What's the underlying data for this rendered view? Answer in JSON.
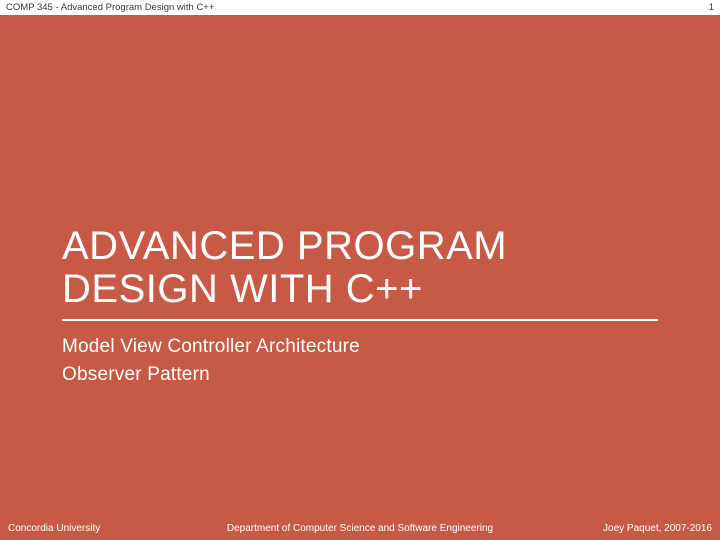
{
  "header": {
    "course": "COMP 345 - Advanced Program Design with C++",
    "page_number": "1"
  },
  "title": "ADVANCED PROGRAM DESIGN WITH C++",
  "subtitles": [
    "Model View Controller Architecture",
    "Observer Pattern"
  ],
  "footer": {
    "left": "Concordia University",
    "center": "Department of Computer Science and Software Engineering",
    "right": "Joey Paquet, 2007-2016"
  },
  "colors": {
    "background": "#c75a46",
    "text": "#ffffff",
    "header_bg": "#ffffff",
    "header_text": "#3a3a3a"
  }
}
